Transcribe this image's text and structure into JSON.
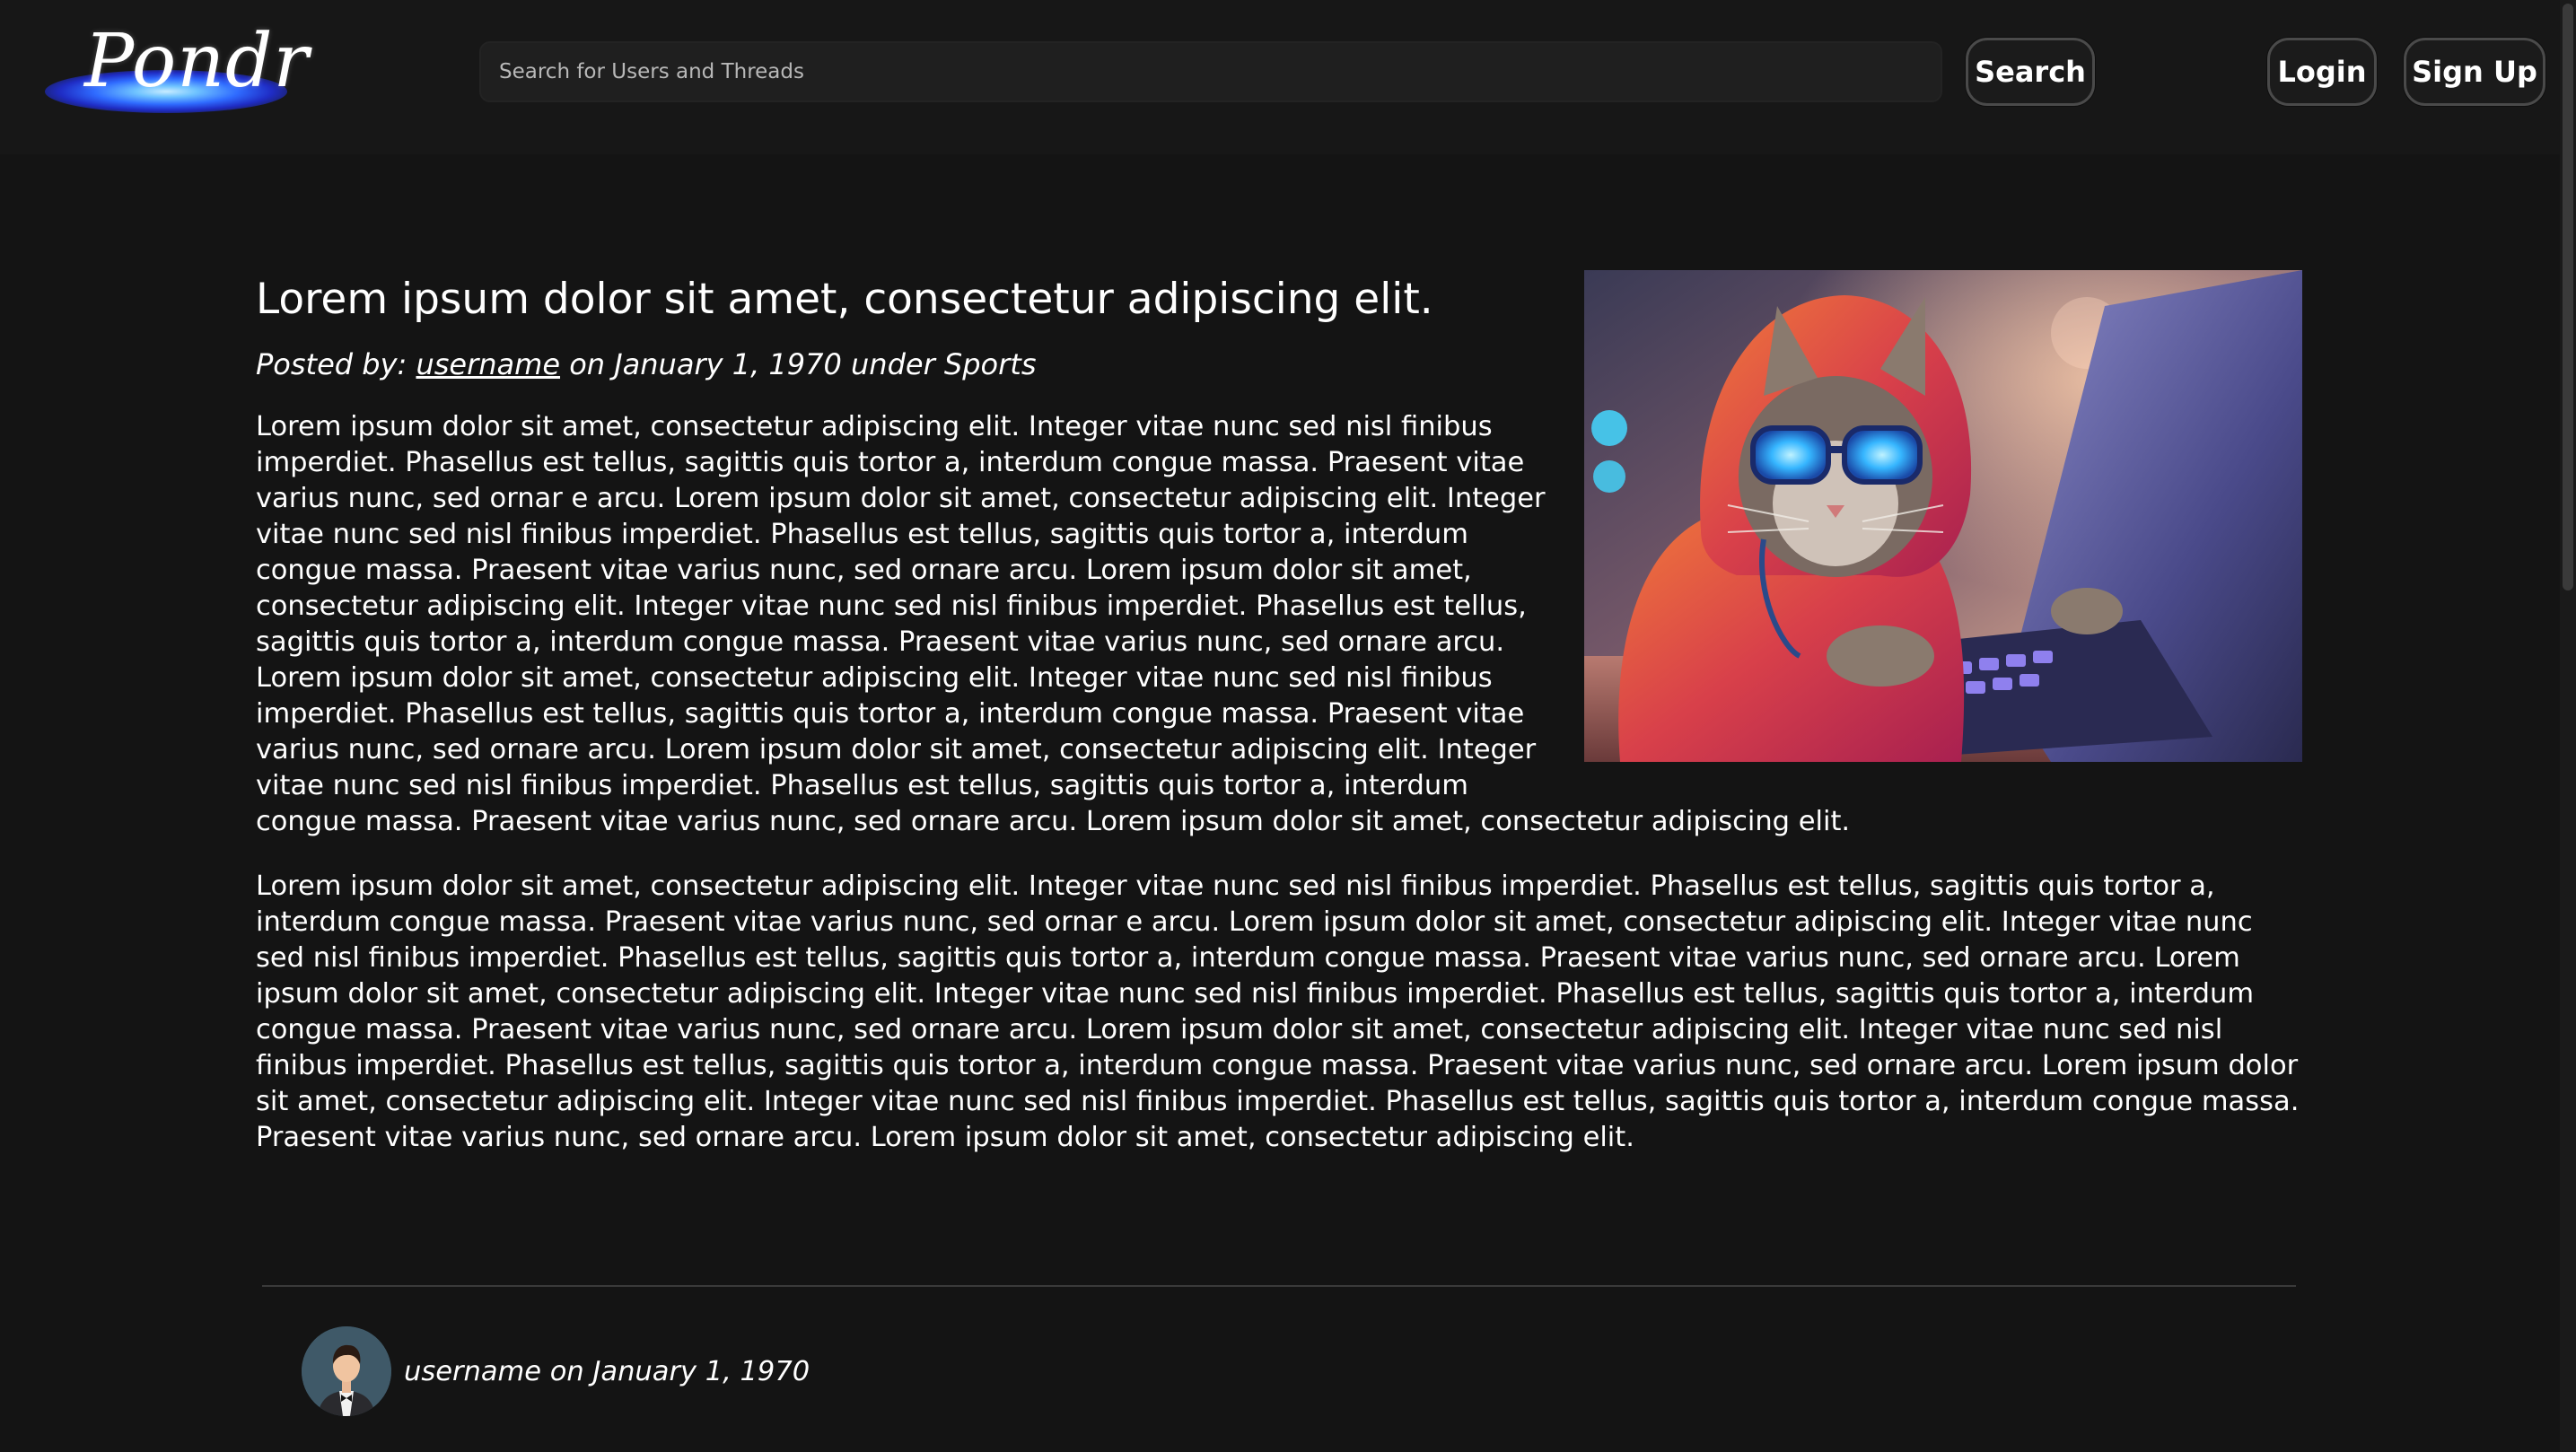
{
  "app": {
    "logo_text": "Pondr"
  },
  "header": {
    "search_placeholder": "Search for Users and Threads",
    "search_button": "Search",
    "login_button": "Login",
    "signup_button": "Sign Up"
  },
  "post": {
    "title": "Lorem ipsum dolor sit amet, consectetur adipiscing elit.",
    "posted_by_prefix": "Posted by: ",
    "author": "username",
    "date_text": " on January 1, 1970 under Sports",
    "paragraphs": [
      "Lorem ipsum dolor sit amet, consectetur adipiscing elit. Integer vitae nunc sed nisl finibus imperdiet. Phasellus est tellus, sagittis quis tortor a, interdum congue massa. Praesent vitae varius nunc, sed ornar e arcu. Lorem ipsum dolor sit amet, consectetur adipiscing elit. Integer vitae nunc sed nisl finibus imperdiet. Phasellus est tellus, sagittis quis tortor a, interdum congue massa. Praesent vitae varius nunc, sed ornare arcu. Lorem ipsum dolor sit amet, consectetur adipiscing elit. Integer vitae nunc sed nisl finibus imperdiet. Phasellus est tellus, sagittis quis tortor a, interdum congue massa. Praesent vitae varius nunc, sed ornare arcu. Lorem ipsum dolor sit amet, consectetur adipiscing elit. Integer vitae nunc sed nisl finibus imperdiet. Phasellus est tellus, sagittis quis tortor a, interdum congue massa. Praesent vitae varius nunc, sed ornare arcu. Lorem ipsum dolor sit amet, consectetur adipiscing elit. Integer vitae nunc sed nisl finibus imperdiet. Phasellus est tellus, sagittis quis tortor a, interdum congue massa. Praesent vitae varius nunc, sed ornare arcu. Lorem ipsum dolor sit amet, consectetur adipiscing elit.",
      "Lorem ipsum dolor sit amet, consectetur adipiscing elit. Integer vitae nunc sed nisl finibus imperdiet. Phasellus est tellus, sagittis quis tortor a, interdum congue massa. Praesent vitae varius nunc, sed ornar e arcu. Lorem ipsum dolor sit amet, consectetur adipiscing elit. Integer vitae nunc sed nisl finibus imperdiet. Phasellus est tellus, sagittis quis tortor a, interdum congue massa. Praesent vitae varius nunc, sed ornare arcu. Lorem ipsum dolor sit amet, consectetur adipiscing elit. Integer vitae nunc sed nisl finibus imperdiet. Phasellus est tellus, sagittis quis tortor a, interdum congue massa. Praesent vitae varius nunc, sed ornare arcu. Lorem ipsum dolor sit amet, consectetur adipiscing elit. Integer vitae nunc sed nisl finibus imperdiet. Phasellus est tellus, sagittis quis tortor a, interdum congue massa. Praesent vitae varius nunc, sed ornare arcu. Lorem ipsum dolor sit amet, consectetur adipiscing elit. Integer vitae nunc sed nisl finibus imperdiet. Phasellus est tellus, sagittis quis tortor a, interdum congue massa. Praesent vitae varius nunc, sed ornare arcu. Lorem ipsum dolor sit amet, consectetur adipiscing elit."
    ]
  },
  "comments": [
    {
      "author_line": "username on January 1, 1970"
    }
  ],
  "colors": {
    "background": "#141414",
    "header": "#171717",
    "text": "#ffffff",
    "logo_glow": "#2f6bff"
  }
}
